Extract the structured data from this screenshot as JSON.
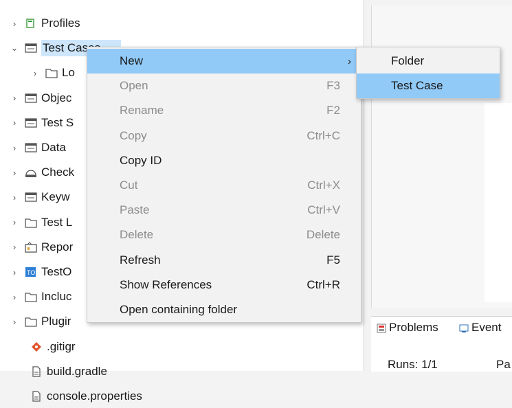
{
  "tree": [
    {
      "label": "Profiles",
      "chevron": "›",
      "icon": "profiles-icon",
      "color": "#3a9a3a"
    },
    {
      "label": "Test Cases",
      "chevron": "⌄",
      "icon": "test-cases-icon",
      "color": "#555555"
    },
    {
      "label": "Lo",
      "chevron": "›",
      "icon": "folder-icon",
      "color": "#5a5a5a"
    },
    {
      "label": "Objec",
      "chevron": "›",
      "icon": "object-repository-icon",
      "color": "#555555"
    },
    {
      "label": "Test S",
      "chevron": "›",
      "icon": "test-suites-icon",
      "color": "#555555"
    },
    {
      "label": "Data",
      "chevron": "›",
      "icon": "data-files-icon",
      "color": "#555555"
    },
    {
      "label": "Check",
      "chevron": "›",
      "icon": "checkpoints-icon",
      "color": "#555555"
    },
    {
      "label": "Keyw",
      "chevron": "›",
      "icon": "keywords-icon",
      "color": "#555555"
    },
    {
      "label": "Test L",
      "chevron": "›",
      "icon": "folder-icon",
      "color": "#5a5a5a"
    },
    {
      "label": "Repor",
      "chevron": "›",
      "icon": "reports-icon",
      "color": "#555555"
    },
    {
      "label": "TestO",
      "chevron": "›",
      "icon": "testops-icon",
      "color": "#2f7fd6"
    },
    {
      "label": "Incluc",
      "chevron": "›",
      "icon": "folder-icon",
      "color": "#5a5a5a"
    },
    {
      "label": "Plugir",
      "chevron": "›",
      "icon": "folder-icon",
      "color": "#5a5a5a"
    },
    {
      "label": ".gitigr",
      "chevron": "",
      "icon": "git-icon",
      "color": "#e2552d"
    },
    {
      "label": "build.gradle",
      "chevron": "",
      "icon": "file-icon",
      "color": "#555555"
    },
    {
      "label": "console.properties",
      "chevron": "",
      "icon": "file-icon",
      "color": "#555555"
    }
  ],
  "context_menu": {
    "items": [
      {
        "label": "New",
        "shortcut": "",
        "arrow": "›",
        "enabled": true,
        "highlighted": true
      },
      {
        "label": "Open",
        "shortcut": "F3",
        "enabled": false
      },
      {
        "label": "Rename",
        "shortcut": "F2",
        "enabled": false
      },
      {
        "label": "Copy",
        "shortcut": "Ctrl+C",
        "enabled": false
      },
      {
        "label": "Copy ID",
        "shortcut": "",
        "enabled": true
      },
      {
        "label": "Cut",
        "shortcut": "Ctrl+X",
        "enabled": false
      },
      {
        "label": "Paste",
        "shortcut": "Ctrl+V",
        "enabled": false
      },
      {
        "label": "Delete",
        "shortcut": "Delete",
        "enabled": false
      },
      {
        "label": "Refresh",
        "shortcut": "F5",
        "enabled": true
      },
      {
        "label": "Show References",
        "shortcut": "Ctrl+R",
        "enabled": true
      },
      {
        "label": "Open containing folder",
        "shortcut": "",
        "enabled": true
      }
    ]
  },
  "submenu": {
    "items": [
      {
        "label": "Folder",
        "highlighted": false
      },
      {
        "label": "Test Case",
        "highlighted": true
      }
    ]
  },
  "bottom_panel": {
    "tabs": [
      {
        "label": "Problems",
        "icon": "problems-icon"
      },
      {
        "label": "Event",
        "icon": "event-log-icon"
      }
    ],
    "runs_label": "Runs: 1/1",
    "pa_label": "Pa"
  },
  "colors": {
    "menu_highlight": "#91c9f7",
    "tree_selection": "#cde6fb",
    "disabled_text": "#8c8c8c"
  }
}
